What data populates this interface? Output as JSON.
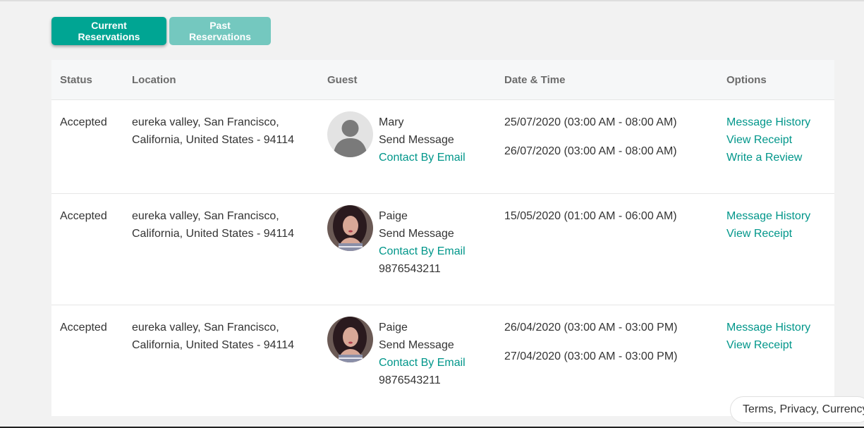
{
  "tabs": {
    "current": "Current Reservations",
    "past": "Past Reservations"
  },
  "columns": {
    "status": "Status",
    "location": "Location",
    "guest": "Guest",
    "datetime": "Date & Time",
    "options": "Options"
  },
  "rows": [
    {
      "status": "Accepted",
      "location_line1": "eureka valley, San Francisco,",
      "location_line2": "California, United States - 94114",
      "guest_name": "Mary",
      "send_message": "Send Message",
      "contact_email": "Contact By Email",
      "phone": "",
      "date1": "25/07/2020 (03:00 AM - 08:00 AM)",
      "date2": "26/07/2020 (03:00 AM - 08:00 AM)",
      "opt1": "Message History",
      "opt2": "View Receipt",
      "opt3": "Write a Review",
      "avatar": "default-avatar"
    },
    {
      "status": "Accepted",
      "location_line1": "eureka valley, San Francisco,",
      "location_line2": "California, United States - 94114",
      "guest_name": "Paige",
      "send_message": "Send Message",
      "contact_email": "Contact By Email",
      "phone": "9876543211",
      "date1": "15/05/2020 (01:00 AM - 06:00 AM)",
      "date2": "",
      "opt1": "Message History",
      "opt2": "View Receipt",
      "opt3": "",
      "avatar": "photo-avatar"
    },
    {
      "status": "Accepted",
      "location_line1": "eureka valley, San Francisco,",
      "location_line2": "California, United States - 94114",
      "guest_name": "Paige",
      "send_message": "Send Message",
      "contact_email": "Contact By Email",
      "phone": "9876543211",
      "date1": "26/04/2020 (03:00 AM - 03:00 PM)",
      "date2": "27/04/2020 (03:00 AM - 03:00 PM)",
      "opt1": "Message History",
      "opt2": "View Receipt",
      "opt3": "",
      "avatar": "photo-avatar"
    }
  ],
  "footer": {
    "label": "Terms, Privacy, Currency & More",
    "icon": "globe-icon"
  },
  "colors": {
    "accent": "#00a593",
    "accent_light": "#74c8bf",
    "link": "#00968a"
  }
}
